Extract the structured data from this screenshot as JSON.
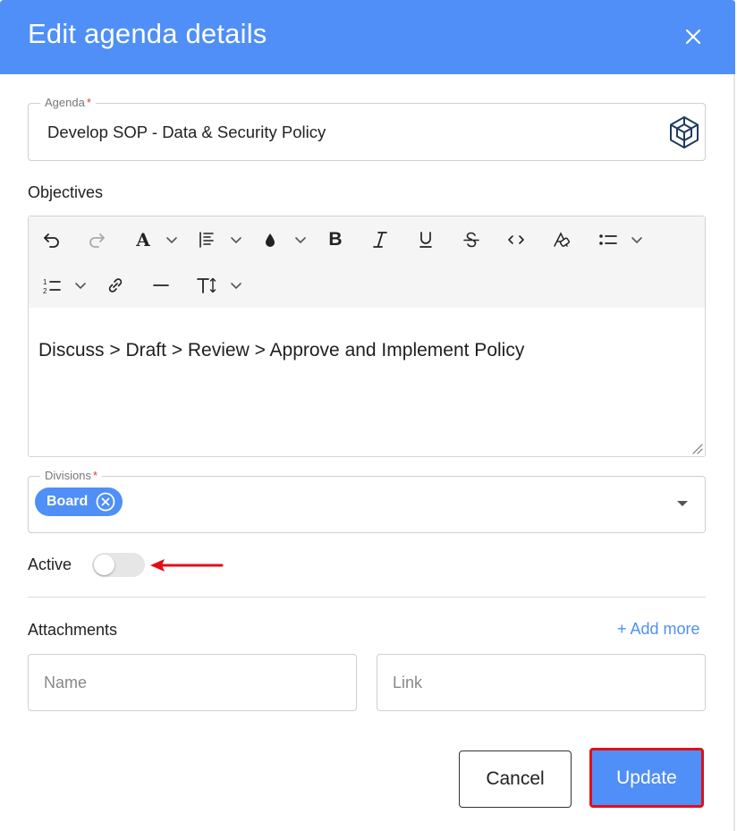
{
  "dialog": {
    "title": "Edit agenda details",
    "close_icon": "close-icon"
  },
  "agenda": {
    "label": "Agenda",
    "required_mark": "*",
    "value": "Develop SOP - Data & Security Policy",
    "logo_icon": "cube-logo-icon"
  },
  "objectives": {
    "label": "Objectives",
    "toolbar": {
      "row1": [
        "undo-icon",
        "redo-icon",
        "font-color-icon",
        "chevron-down-icon",
        "line-height-icon",
        "chevron-down-icon",
        "fill-color-icon",
        "chevron-down-icon",
        "bold-icon",
        "italic-icon",
        "underline-icon",
        "strikethrough-icon",
        "code-icon",
        "clear-format-icon",
        "bulleted-list-icon",
        "chevron-down-icon"
      ],
      "row2": [
        "numbered-list-icon",
        "chevron-down-icon",
        "link-icon",
        "horizontal-rule-icon",
        "font-size-icon",
        "chevron-down-icon"
      ],
      "bold_glyph": "B",
      "italic_glyph": "I",
      "underline_glyph": "U",
      "strike_glyph": "S",
      "font_color_glyph": "A",
      "font_size_glyph": "T",
      "code_glyph": "‹ ›"
    },
    "content": "Discuss > Draft > Review > Approve and Implement Policy"
  },
  "divisions": {
    "label": "Divisions",
    "required_mark": "*",
    "chips": [
      "Board"
    ]
  },
  "active": {
    "label": "Active",
    "enabled": false
  },
  "attachments": {
    "label": "Attachments",
    "add_more": "+ Add more",
    "name_placeholder": "Name",
    "link_placeholder": "Link"
  },
  "actions": {
    "cancel": "Cancel",
    "update": "Update"
  },
  "colors": {
    "primary": "#4f8ff7",
    "required": "#e53935",
    "highlight": "#e0101a",
    "toggle_off": "#e6e6e6"
  }
}
